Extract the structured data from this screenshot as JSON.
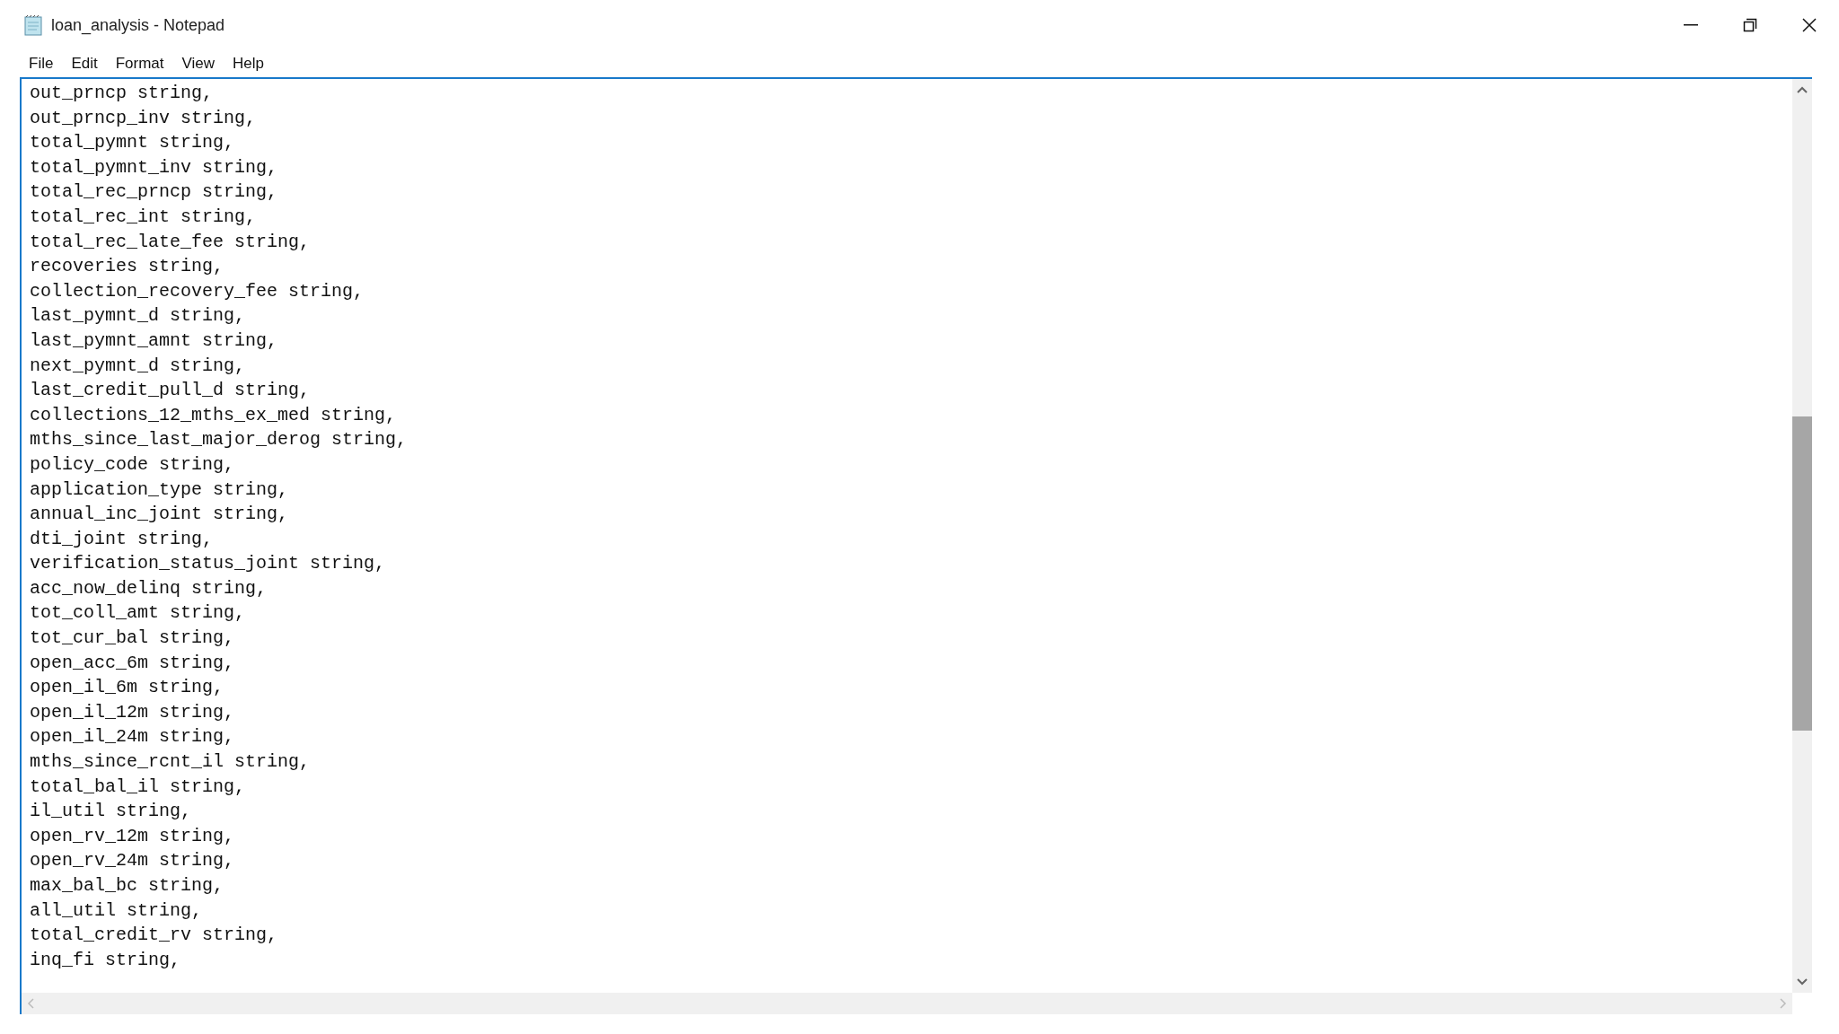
{
  "window": {
    "title": "loan_analysis - Notepad"
  },
  "menu": [
    "File",
    "Edit",
    "Format",
    "View",
    "Help"
  ],
  "editor": {
    "lines": [
      "out_prncp string,",
      "out_prncp_inv string,",
      "total_pymnt string,",
      "total_pymnt_inv string,",
      "total_rec_prncp string,",
      "total_rec_int string,",
      "total_rec_late_fee string,",
      "recoveries string,",
      "collection_recovery_fee string,",
      "last_pymnt_d string,",
      "last_pymnt_amnt string,",
      "next_pymnt_d string,",
      "last_credit_pull_d string,",
      "collections_12_mths_ex_med string,",
      "mths_since_last_major_derog string,",
      "policy_code string,",
      "application_type string,",
      "annual_inc_joint string,",
      "dti_joint string,",
      "verification_status_joint string,",
      "acc_now_delinq string,",
      "tot_coll_amt string,",
      "tot_cur_bal string,",
      "open_acc_6m string,",
      "open_il_6m string,",
      "open_il_12m string,",
      "open_il_24m string,",
      "mths_since_rcnt_il string,",
      "total_bal_il string,",
      "il_util string,",
      "open_rv_12m string,",
      "open_rv_24m string,",
      "max_bal_bc string,",
      "all_util string,",
      "total_credit_rv string,",
      "inq_fi string,"
    ]
  }
}
